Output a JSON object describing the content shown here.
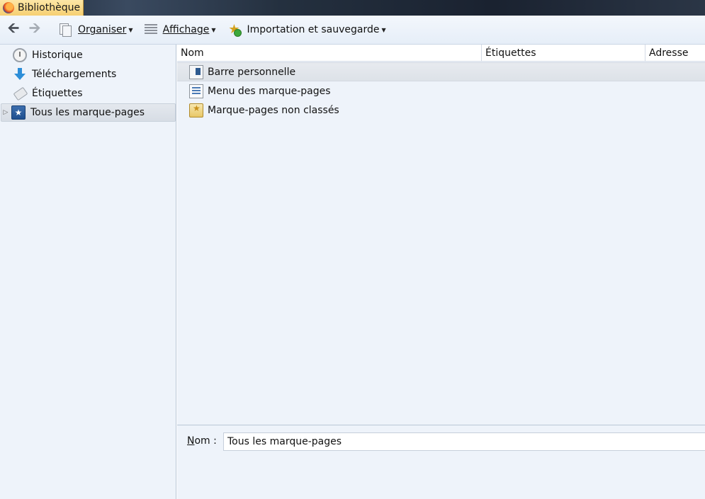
{
  "window": {
    "title": "Bibliothèque"
  },
  "toolbar": {
    "back_label": "🡨",
    "forward_label": "🡪",
    "organise_label": "Organiser",
    "view_label": "Affichage",
    "import_label": "Importation et sauvegarde"
  },
  "sidebar": {
    "items": [
      {
        "label": "Historique",
        "icon": "history-clock-icon"
      },
      {
        "label": "Téléchargements",
        "icon": "download-arrow-icon"
      },
      {
        "label": "Étiquettes",
        "icon": "tag-icon"
      },
      {
        "label": "Tous les marque-pages",
        "icon": "bookmarks-star-icon",
        "selected": true,
        "expandable": true
      }
    ]
  },
  "columns": {
    "name": "Nom",
    "tags": "Étiquettes",
    "address": "Adresse"
  },
  "rows": [
    {
      "label": "Barre personnelle",
      "icon": "bookmarks-toolbar-icon",
      "selected": true
    },
    {
      "label": "Menu des marque-pages",
      "icon": "bookmarks-menu-icon"
    },
    {
      "label": "Marque-pages non classés",
      "icon": "unsorted-bookmarks-icon"
    }
  ],
  "details": {
    "name_label_first": "N",
    "name_label_rest": "om :",
    "name_value": "Tous les marque-pages"
  }
}
